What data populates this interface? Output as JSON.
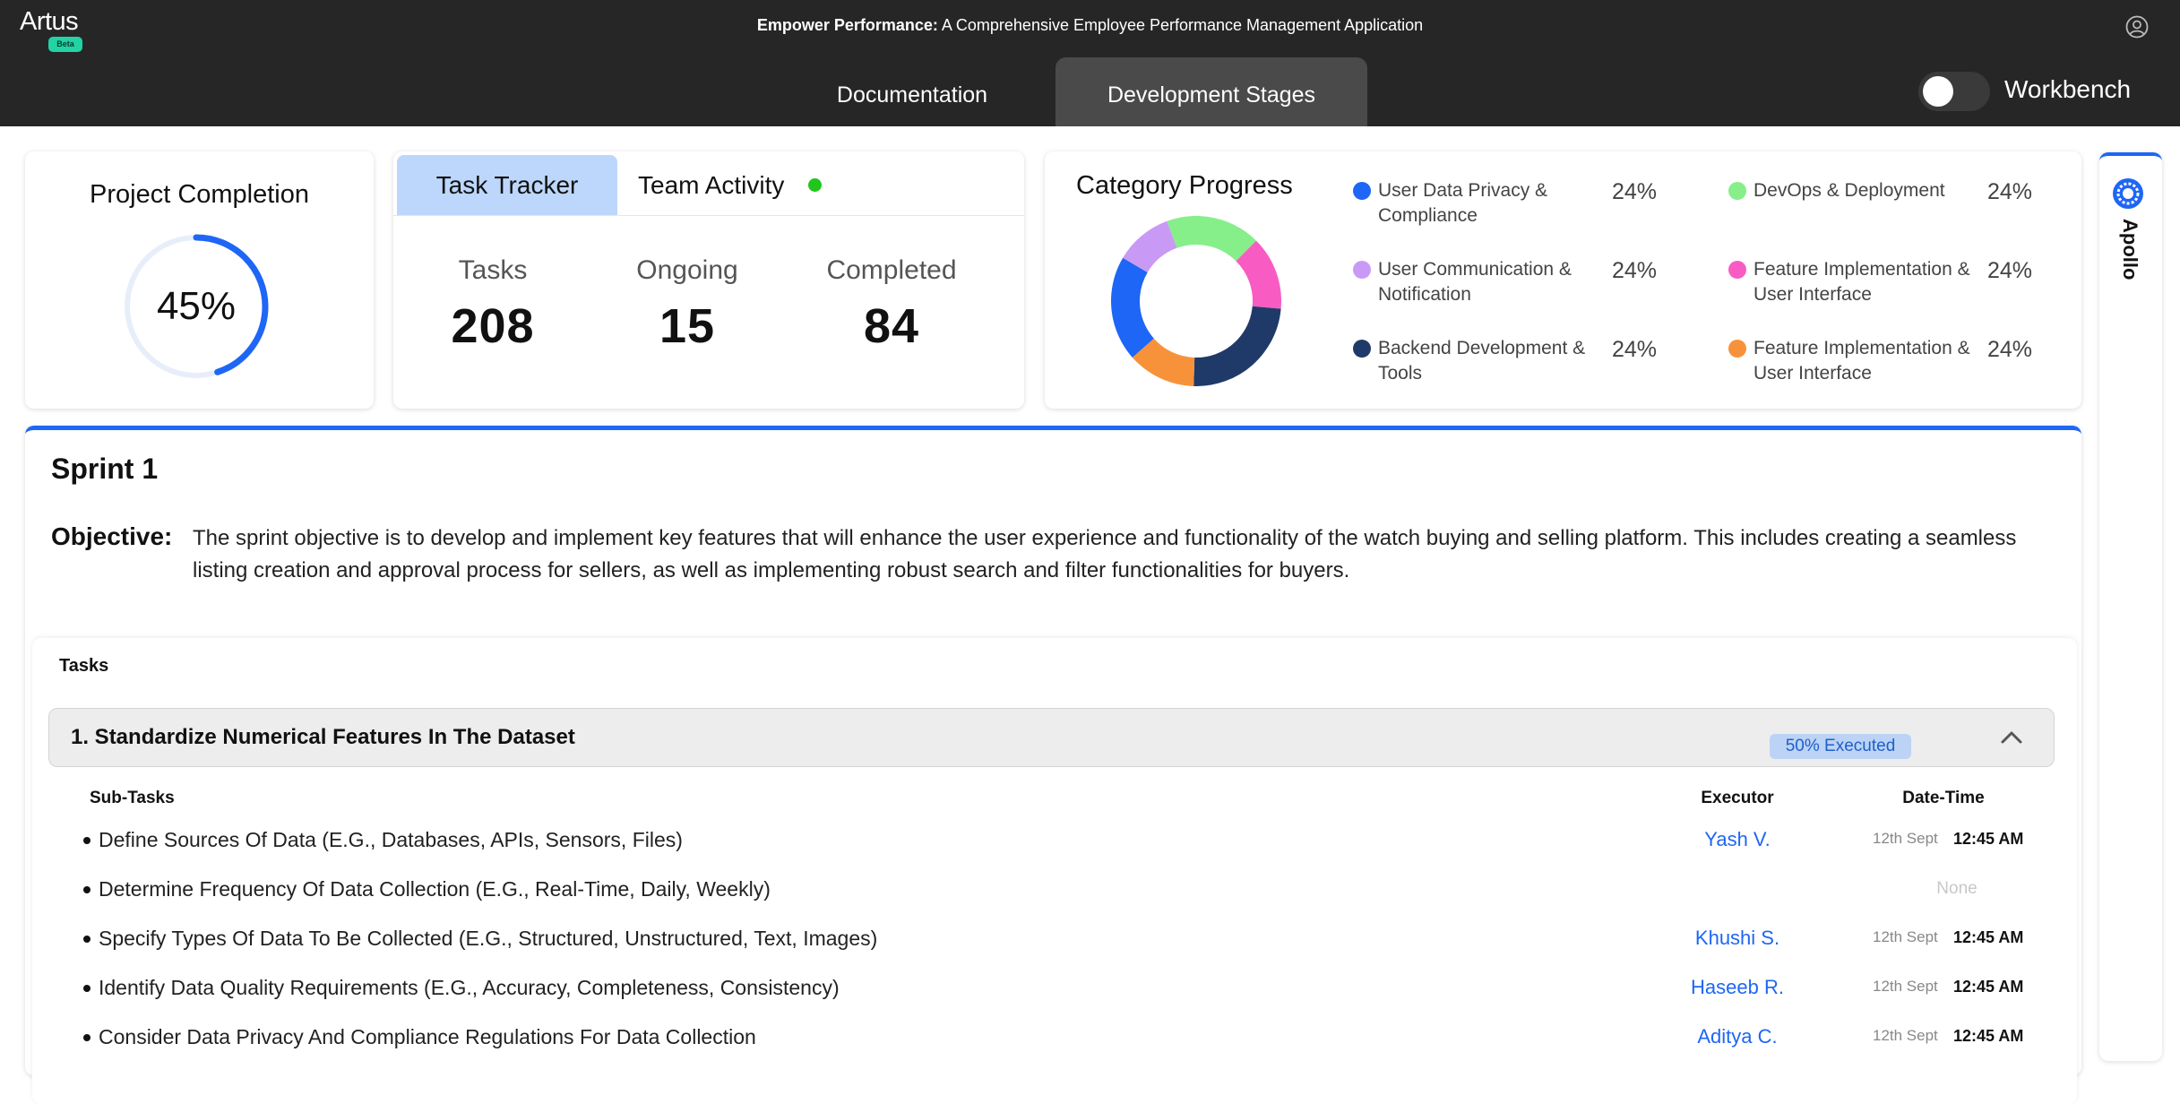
{
  "header": {
    "logo": {
      "brand": "Artus",
      "badge": "Beta"
    },
    "title_bold": "Empower Performance:",
    "title_rest": " A Comprehensive Employee Performance Management Application",
    "tabs": [
      {
        "label": "Documentation",
        "active": false
      },
      {
        "label": "Development Stages",
        "active": true
      }
    ],
    "workbench_label": "Workbench",
    "workbench_on": false
  },
  "completion": {
    "title": "Project Completion",
    "value_text": "45%",
    "value": 0.45
  },
  "tracker": {
    "tabs": [
      {
        "label": "Task Tracker"
      },
      {
        "label": "Team Activity"
      }
    ],
    "stats": [
      {
        "label": "Tasks",
        "value": "208"
      },
      {
        "label": "Ongoing",
        "value": "15"
      },
      {
        "label": "Completed",
        "value": "84"
      }
    ]
  },
  "category": {
    "title": "Category Progress",
    "items": [
      {
        "label": "User Data Privacy & Compliance",
        "pct": "24%",
        "color": "#1e66f5"
      },
      {
        "label": "DevOps & Deployment",
        "pct": "24%",
        "color": "#86ef8a"
      },
      {
        "label": "User Communication & Notification",
        "pct": "24%",
        "color": "#c99af5"
      },
      {
        "label": "Feature Implementation & User Interface",
        "pct": "24%",
        "color": "#f85cc3"
      },
      {
        "label": "Backend Development & Tools",
        "pct": "24%",
        "color": "#1f3a68"
      },
      {
        "label": "Feature Implementation & User Interface",
        "pct": "24%",
        "color": "#f8923a"
      }
    ],
    "donut_order": [
      "#86ef8a",
      "#f85cc3",
      "#1f3a68",
      "#f8923a",
      "#1e66f5",
      "#c99af5"
    ],
    "donut_values": [
      0.18,
      0.14,
      0.24,
      0.13,
      0.2,
      0.11
    ]
  },
  "apollo": {
    "label": "Apollo"
  },
  "sprint": {
    "title": "Sprint 1",
    "objective_label": "Objective:",
    "objective_text": "The sprint objective is to develop and implement key features that will enhance the user experience and functionality of the watch buying and selling platform. This includes creating a seamless listing creation and approval process for sellers, as well as implementing robust search and filter functionalities for buyers.",
    "tasks_heading": "Tasks",
    "task": {
      "title": "1. Standardize Numerical Features In The Dataset",
      "badge": "50% Executed",
      "columns": {
        "subtasks": "Sub-Tasks",
        "executor": "Executor",
        "datetime": "Date-Time"
      },
      "subtasks": [
        {
          "text": "Define Sources Of Data (E.G., Databases, APIs, Sensors, Files)",
          "executor": "Yash V.",
          "date": "12th Sept",
          "time": "12:45 AM"
        },
        {
          "text": "Determine Frequency Of Data Collection (E.G., Real-Time, Daily, Weekly)",
          "executor": "",
          "date": "",
          "time": "",
          "none": "None"
        },
        {
          "text": "Specify Types Of Data To Be Collected (E.G., Structured, Unstructured, Text, Images)",
          "executor": "Khushi S.",
          "date": "12th Sept",
          "time": "12:45 AM"
        },
        {
          "text": "Identify Data Quality Requirements (E.G., Accuracy, Completeness, Consistency)",
          "executor": "Haseeb R.",
          "date": "12th Sept",
          "time": "12:45 AM"
        },
        {
          "text": "Consider Data Privacy And Compliance Regulations For Data Collection",
          "executor": "Aditya C.",
          "date": "12th Sept",
          "time": "12:45 AM"
        }
      ]
    }
  }
}
